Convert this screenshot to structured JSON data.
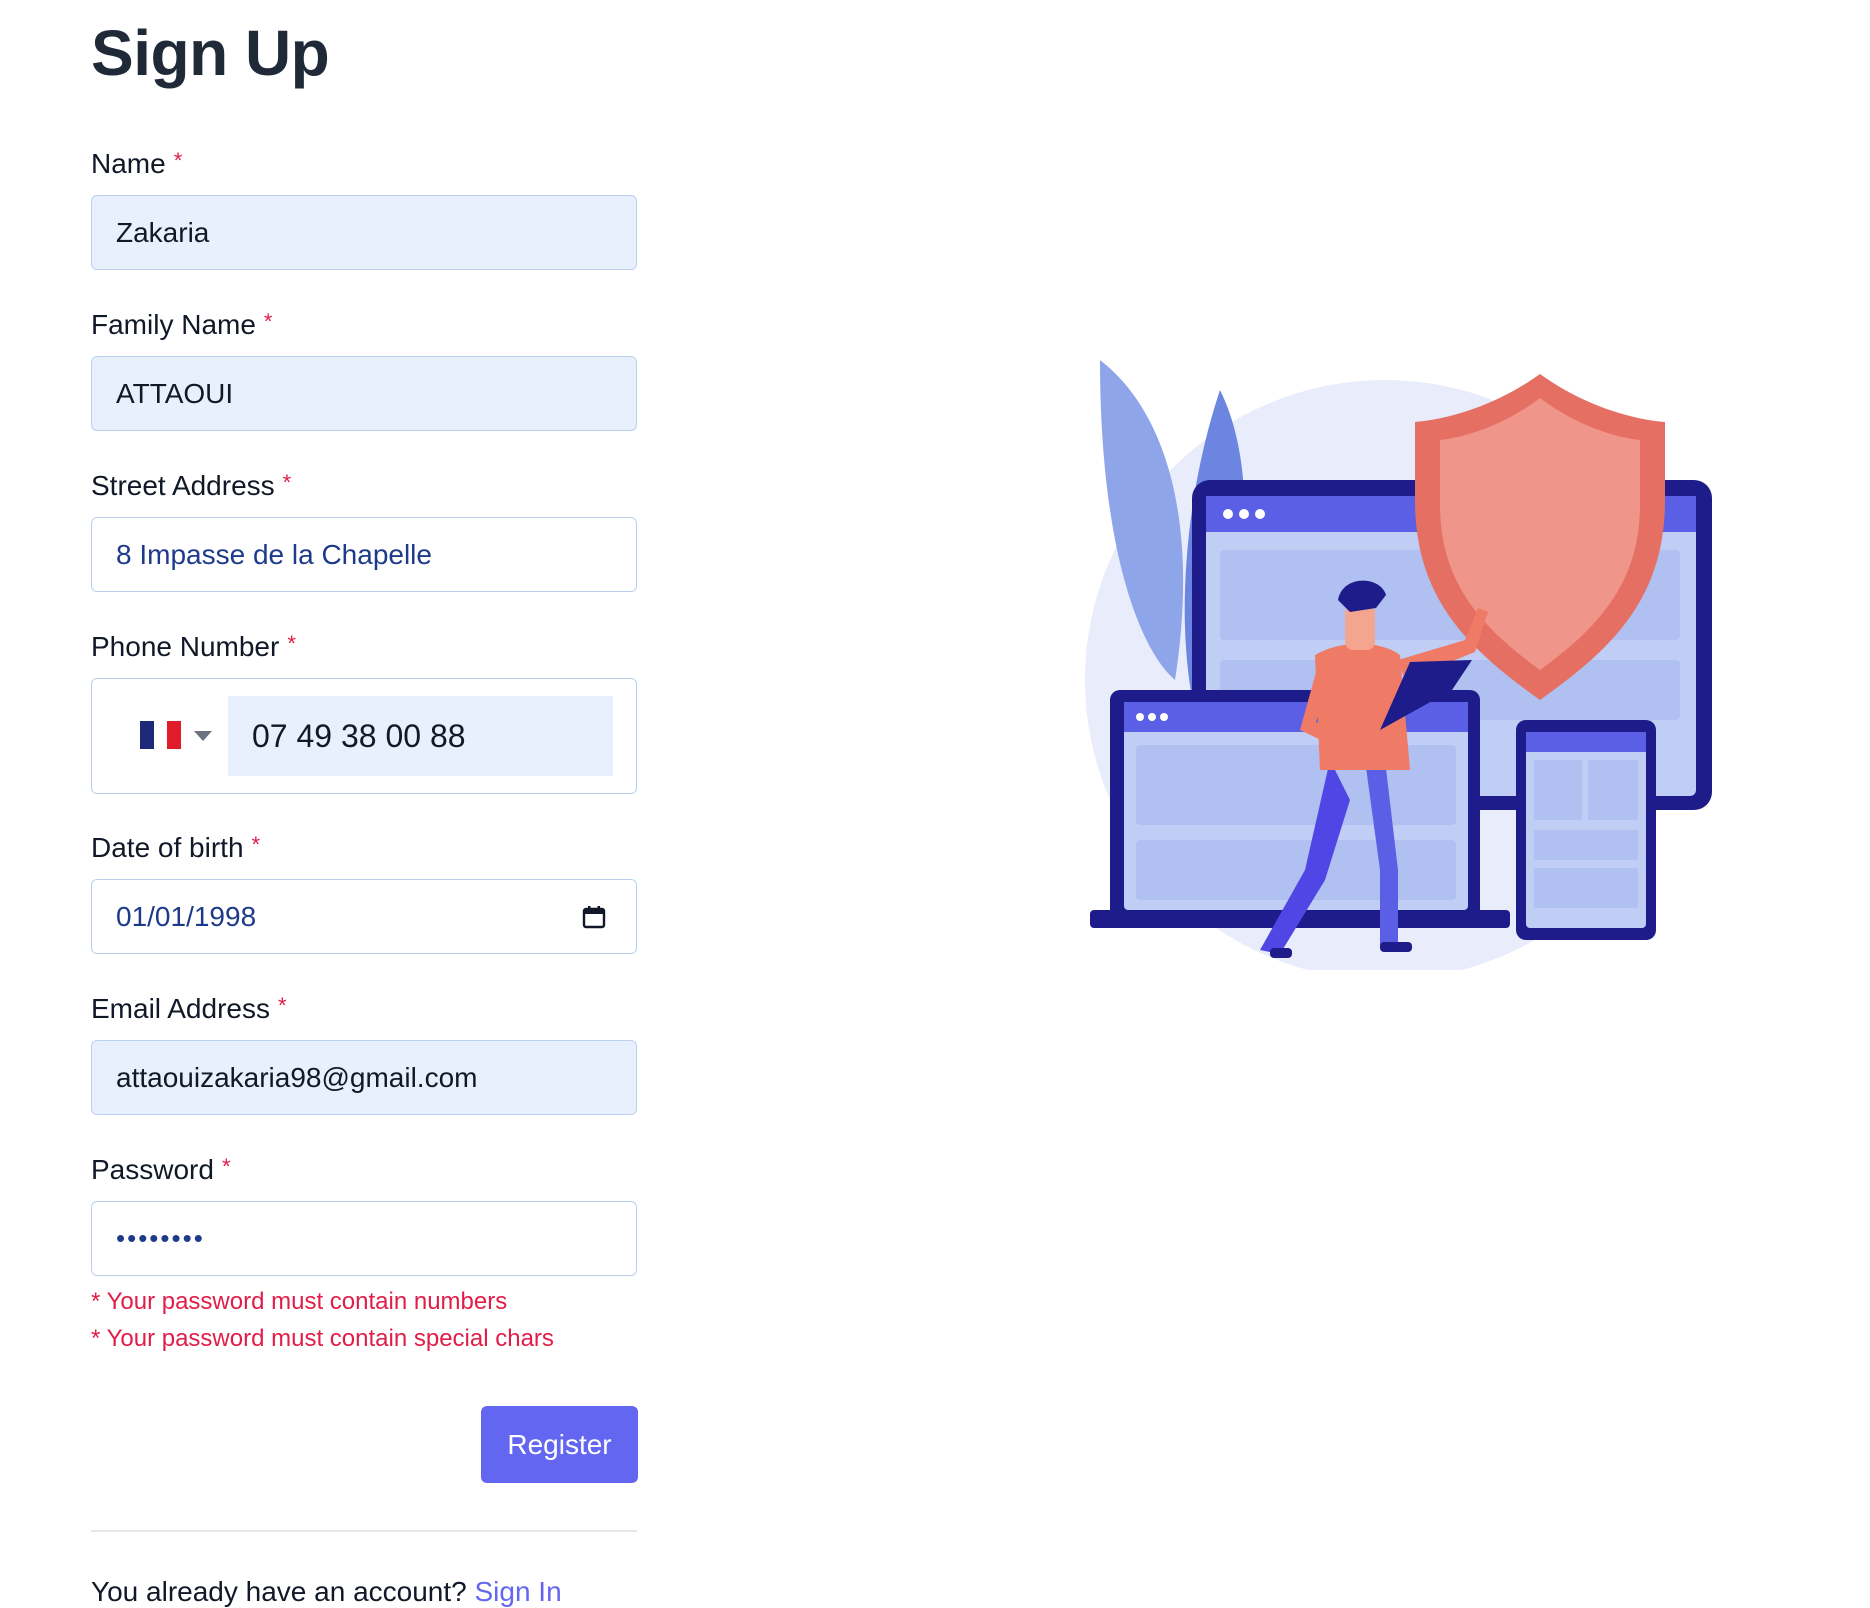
{
  "page": {
    "title": "Sign Up"
  },
  "form": {
    "name": {
      "label": "Name",
      "required_mark": "*",
      "value": "Zakaria"
    },
    "family_name": {
      "label": "Family Name",
      "required_mark": "*",
      "value": "ATTAOUI"
    },
    "street_address": {
      "label": "Street Address",
      "required_mark": "*",
      "value": "8 Impasse de la Chapelle"
    },
    "phone": {
      "label": "Phone Number",
      "required_mark": "*",
      "country_icon": "france-flag-icon",
      "value": "07 49 38 00 88"
    },
    "dob": {
      "label": "Date of birth",
      "required_mark": "*",
      "value": "01/01/1998"
    },
    "email": {
      "label": "Email Address",
      "required_mark": "*",
      "value": "attaouizakaria98@gmail.com"
    },
    "password": {
      "label": "Password",
      "required_mark": "*",
      "value": "••••••••"
    },
    "errors": [
      "* Your password must contain numbers",
      "* Your password must contain special chars"
    ],
    "register_label": "Register"
  },
  "footer": {
    "text": "You already have an account?",
    "link_label": "Sign In"
  },
  "colors": {
    "accent": "#6366f1",
    "error": "#e11d48",
    "autofill_bg": "#e8f0fe",
    "shield": "#e46f62"
  }
}
